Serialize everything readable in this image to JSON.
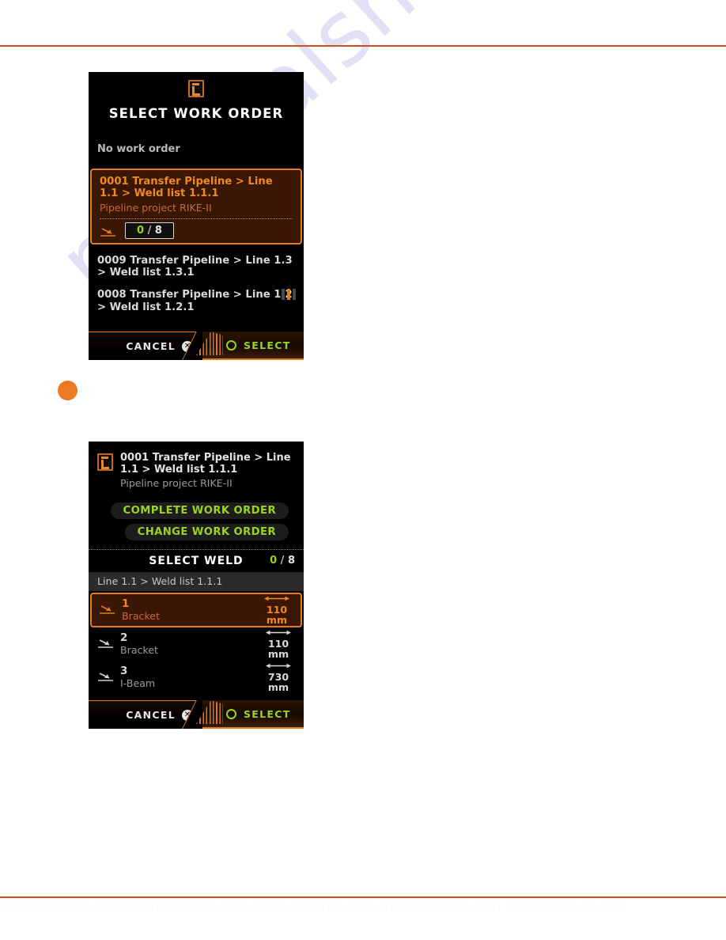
{
  "page": {
    "watermark_text": "manualshive.com",
    "footer_faint_text": "manualshive.com manualshive.com manualshive.com manualshive.com manualshive.com",
    "rule_color": "#c4551f",
    "step_marker": {
      "name": "step-bullet",
      "color": "#ec7a23"
    }
  },
  "screen_work_order": {
    "icon": "work-order-document-icon",
    "title": "SELECT WORK ORDER",
    "no_work_order_label": "No work order",
    "selected_card": {
      "path": "0001 Transfer Pipeline > Line 1.1 > Weld list 1.1.1",
      "project": "Pipeline project RIKE-II",
      "weld_icon": "weld-symbol-icon",
      "count_done": "0",
      "count_separator": "/",
      "count_total": "8"
    },
    "rows": [
      {
        "path": "0009 Transfer Pipeline > Line 1.3 > Weld list 1.3.1"
      },
      {
        "path": "0008 Transfer Pipeline > Line 1.2 > Weld list 1.2.1"
      }
    ],
    "scroll_indicator": "scroll-position-indicator",
    "action_bar": {
      "cancel_label": "CANCEL",
      "cancel_icon": "cancel-x-icon",
      "select_label": "SELECT",
      "select_icon": "select-circle-icon"
    }
  },
  "screen_weld": {
    "icon": "work-order-document-icon",
    "header_path": "0001 Transfer Pipeline > Line 1.1 > Weld list 1.1.1",
    "header_project": "Pipeline project RIKE-II",
    "buttons": [
      {
        "label": "COMPLETE WORK ORDER"
      },
      {
        "label": "CHANGE WORK ORDER"
      }
    ],
    "section_title": "SELECT WELD",
    "section_count_done": "0",
    "section_count_separator": "/",
    "section_count_total": "8",
    "breadcrumb": "Line 1.1 > Weld list 1.1.1",
    "weld_rows": [
      {
        "num": "1",
        "type": "Bracket",
        "value": "110",
        "unit": "mm",
        "selected": true
      },
      {
        "num": "2",
        "type": "Bracket",
        "value": "110",
        "unit": "mm",
        "selected": false
      },
      {
        "num": "3",
        "type": "I-Beam",
        "value": "730",
        "unit": "mm",
        "selected": false
      }
    ],
    "action_bar": {
      "cancel_label": "CANCEL",
      "cancel_icon": "cancel-x-icon",
      "select_label": "SELECT",
      "select_icon": "select-circle-icon"
    }
  },
  "colors": {
    "accent_orange": "#e07c20",
    "accent_orange_text": "#f08a1e",
    "accent_green": "#9ad41e",
    "card_bg": "#3a1605",
    "screen_bg": "#000000"
  }
}
